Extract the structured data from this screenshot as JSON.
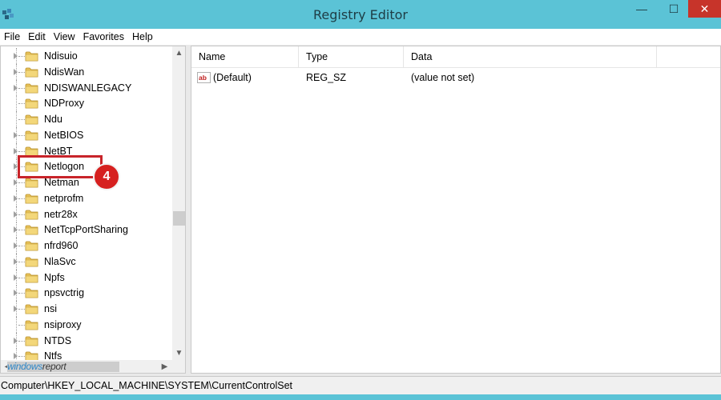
{
  "window": {
    "title": "Registry Editor",
    "minimize_glyph": "—",
    "maximize_glyph": "☐",
    "close_glyph": "✕",
    "accent": "#5bc3d6",
    "close_color": "#c7342a"
  },
  "menu": [
    "File",
    "Edit",
    "View",
    "Favorites",
    "Help"
  ],
  "tree": {
    "items": [
      {
        "label": "Ndisuio",
        "expandable": true
      },
      {
        "label": "NdisWan",
        "expandable": true
      },
      {
        "label": "NDISWANLEGACY",
        "expandable": true
      },
      {
        "label": "NDProxy",
        "expandable": false
      },
      {
        "label": "Ndu",
        "expandable": false
      },
      {
        "label": "NetBIOS",
        "expandable": true
      },
      {
        "label": "NetBT",
        "expandable": true
      },
      {
        "label": "Netlogon",
        "expandable": true
      },
      {
        "label": "Netman",
        "expandable": true
      },
      {
        "label": "netprofm",
        "expandable": true
      },
      {
        "label": "netr28x",
        "expandable": true
      },
      {
        "label": "NetTcpPortSharing",
        "expandable": true
      },
      {
        "label": "nfrd960",
        "expandable": true
      },
      {
        "label": "NlaSvc",
        "expandable": true
      },
      {
        "label": "Npfs",
        "expandable": true
      },
      {
        "label": "npsvctrig",
        "expandable": true
      },
      {
        "label": "nsi",
        "expandable": true
      },
      {
        "label": "nsiproxy",
        "expandable": false
      },
      {
        "label": "NTDS",
        "expandable": true
      },
      {
        "label": "Ntfs",
        "expandable": true
      }
    ],
    "scroll_up": "▲",
    "scroll_down": "▼",
    "scroll_left": "◀",
    "scroll_right": "▶"
  },
  "annotation": {
    "badge_number": "4",
    "color": "#c8242a"
  },
  "watermark": {
    "part1": "windows",
    "part2": "report"
  },
  "values": {
    "columns": [
      "Name",
      "Type",
      "Data"
    ],
    "rows": [
      {
        "name": "(Default)",
        "type": "REG_SZ",
        "data": "(value not set)",
        "icon": "string-value-icon"
      }
    ]
  },
  "status": {
    "path": "Computer\\HKEY_LOCAL_MACHINE\\SYSTEM\\CurrentControlSet"
  }
}
